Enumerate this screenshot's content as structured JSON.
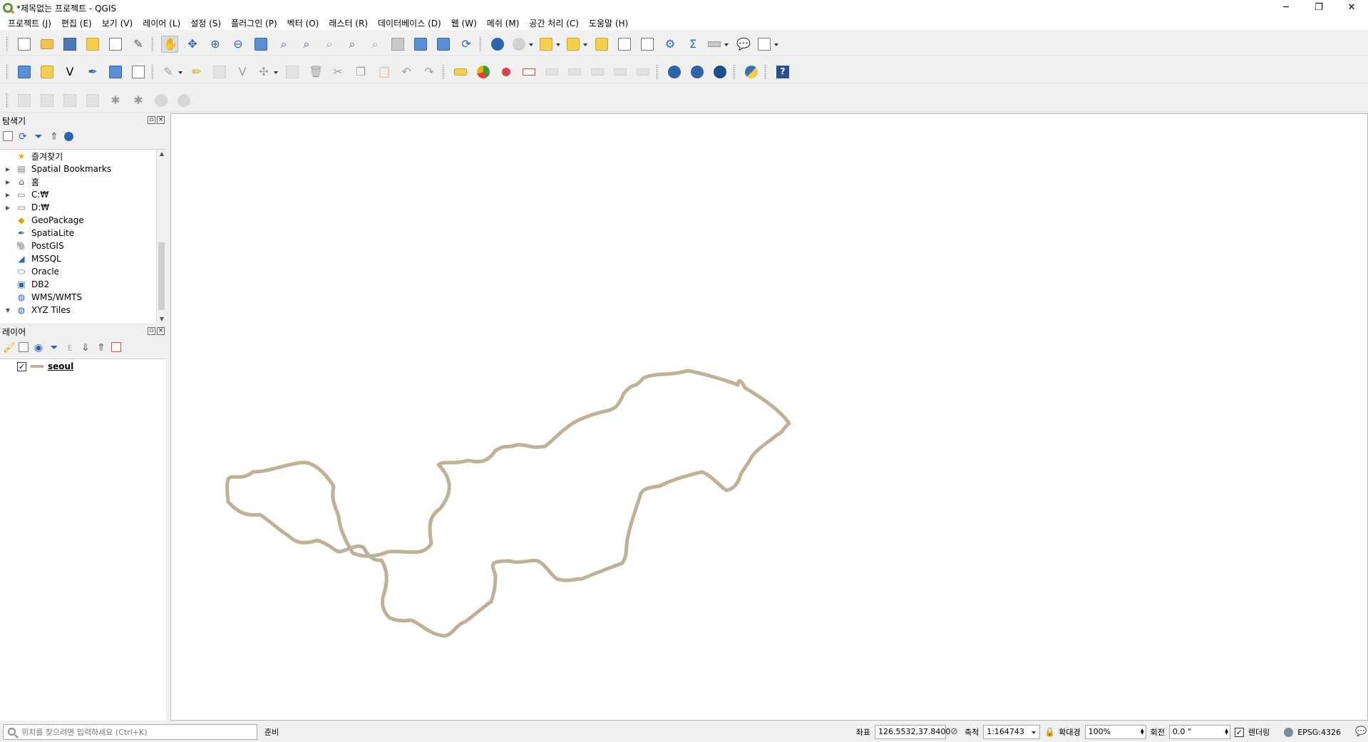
{
  "window": {
    "title": "*제목없는 프로젝트 - QGIS",
    "controls": [
      "─",
      "❐",
      "✕"
    ]
  },
  "menu": [
    "프로젝트 (J)",
    "편집 (E)",
    "보기 (V)",
    "레이어 (L)",
    "설정 (S)",
    "플러그인 (P)",
    "벡터 (O)",
    "래스터 (R)",
    "데이터베이스 (D)",
    "웹 (W)",
    "메쉬 (M)",
    "공간 처리 (C)",
    "도움말 (H)"
  ],
  "browser": {
    "title": "탐색기",
    "items": [
      {
        "label": "즐겨찾기",
        "icon": "star-icon",
        "arrow": ""
      },
      {
        "label": "Spatial Bookmarks",
        "icon": "bookmark-icon",
        "arrow": "▶"
      },
      {
        "label": "홈",
        "icon": "home-icon",
        "arrow": "▶"
      },
      {
        "label": "C:₩",
        "icon": "folder-icon",
        "arrow": "▶"
      },
      {
        "label": "D:₩",
        "icon": "folder-icon",
        "arrow": "▶"
      },
      {
        "label": "GeoPackage",
        "icon": "geopackage-icon",
        "arrow": ""
      },
      {
        "label": "SpatiaLite",
        "icon": "spatialite-icon",
        "arrow": ""
      },
      {
        "label": "PostGIS",
        "icon": "postgis-icon",
        "arrow": ""
      },
      {
        "label": "MSSQL",
        "icon": "mssql-icon",
        "arrow": ""
      },
      {
        "label": "Oracle",
        "icon": "oracle-icon",
        "arrow": ""
      },
      {
        "label": "DB2",
        "icon": "db2-icon",
        "arrow": ""
      },
      {
        "label": "WMS/WMTS",
        "icon": "wms-icon",
        "arrow": ""
      },
      {
        "label": "XYZ Tiles",
        "icon": "xyz-icon",
        "arrow": "▼"
      }
    ]
  },
  "layers_panel": {
    "title": "레이어",
    "layers": [
      {
        "name": "seoul",
        "checked": true,
        "symbol_color": "#bfb197"
      }
    ]
  },
  "map": {
    "outline_color": "#bfb197"
  },
  "status": {
    "locator_placeholder": "위치를 찾으려면 입력하세요 (Ctrl+K)",
    "message": "준비",
    "coord_label": "좌표",
    "coord_value": "126.5532,37.8400",
    "scale_label": "축척",
    "scale_value": "1:164743",
    "magnifier_label": "확대경",
    "magnifier_value": "100%",
    "rotation_label": "회전",
    "rotation_value": "0.0 °",
    "render_label": "렌더링",
    "crs": "EPSG:4326"
  }
}
